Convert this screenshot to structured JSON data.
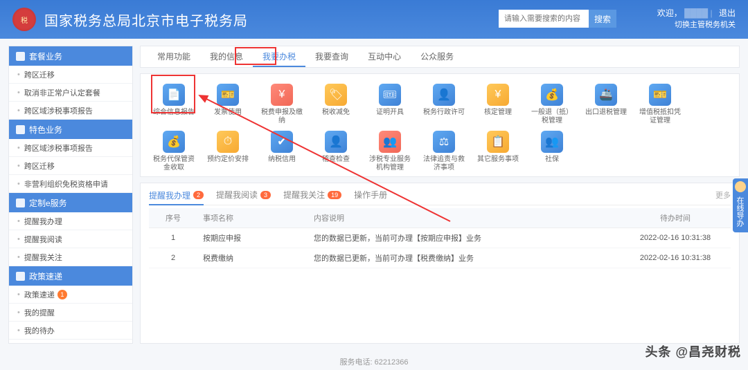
{
  "header": {
    "title": "国家税务总局北京市电子税务局",
    "search_placeholder": "请输入需要搜索的内容",
    "search_btn": "搜索",
    "welcome": "欢迎，",
    "logout": "退出",
    "switch_org": "切换主管税务机关"
  },
  "sidebar": {
    "sections": [
      {
        "title": "套餐业务",
        "items": [
          "跨区迁移",
          "取消非正常户认定套餐",
          "跨区域涉税事项报告"
        ]
      },
      {
        "title": "特色业务",
        "items": [
          "跨区域涉税事项报告",
          "跨区迁移",
          "非营利组织免税资格申请"
        ]
      },
      {
        "title": "定制e服务",
        "items": [
          "提醒我办理",
          "提醒我阅读",
          "提醒我关注"
        ]
      },
      {
        "title": "政策速递",
        "items": [
          "政策速递",
          "我的提醒",
          "我的待办"
        ]
      }
    ],
    "policy_badge": "1"
  },
  "main_tabs": [
    "常用功能",
    "我的信息",
    "我要办税",
    "我要查询",
    "互动中心",
    "公众服务"
  ],
  "main_tab_active": 2,
  "grid": [
    {
      "label": "综合信息报告",
      "c": "b",
      "g": "📄"
    },
    {
      "label": "发票使用",
      "c": "b",
      "g": "🎫"
    },
    {
      "label": "税费申报及缴纳",
      "c": "r",
      "g": "¥"
    },
    {
      "label": "税收减免",
      "c": "y",
      "g": "🏷"
    },
    {
      "label": "证明开具",
      "c": "b",
      "g": "🎟"
    },
    {
      "label": "税务行政许可",
      "c": "b",
      "g": "👤"
    },
    {
      "label": "核定管理",
      "c": "y",
      "g": "¥"
    },
    {
      "label": "一般退（抵）税管理",
      "c": "b",
      "g": "💰"
    },
    {
      "label": "出口退税管理",
      "c": "b",
      "g": "🚢"
    },
    {
      "label": "增值税抵扣凭证管理",
      "c": "b",
      "g": "🎫"
    },
    {
      "label": "税务代保管资金收取",
      "c": "b",
      "g": "💰"
    },
    {
      "label": "预约定价安排",
      "c": "y",
      "g": "⏱"
    },
    {
      "label": "纳税信用",
      "c": "b",
      "g": "✔"
    },
    {
      "label": "稽查检查",
      "c": "b",
      "g": "👤"
    },
    {
      "label": "涉税专业服务机构管理",
      "c": "r",
      "g": "👥"
    },
    {
      "label": "法律追责与救济事项",
      "c": "b",
      "g": "⚖"
    },
    {
      "label": "其它服务事项",
      "c": "y",
      "g": "📋"
    },
    {
      "label": "社保",
      "c": "b",
      "g": "👥"
    }
  ],
  "notice_tabs": [
    {
      "label": "提醒我办理",
      "count": "2"
    },
    {
      "label": "提醒我阅读",
      "count": "3"
    },
    {
      "label": "提醒我关注",
      "count": "19"
    },
    {
      "label": "操作手册",
      "count": ""
    }
  ],
  "more": "更多",
  "table": {
    "headers": [
      "序号",
      "事项名称",
      "内容说明",
      "待办时间"
    ],
    "rows": [
      {
        "no": "1",
        "name": "按期应申报",
        "desc": "您的数据已更新，当前可办理【按期应申报】业务",
        "time": "2022-02-16 10:31:38"
      },
      {
        "no": "2",
        "name": "税费缴纳",
        "desc": "您的数据已更新，当前可办理【税费缴纳】业务",
        "time": "2022-02-16 10:31:38"
      }
    ]
  },
  "footer_phone_label": "服务电话: 62212366",
  "float_help": "在线导办",
  "watermark": "头条 @昌尧财税"
}
